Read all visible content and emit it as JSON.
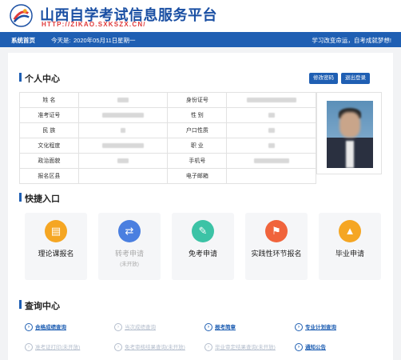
{
  "header": {
    "title": "山西自学考试信息服务平台",
    "url": "HTTP://ZIKAO.SXKSZX.CN/"
  },
  "navbar": {
    "home": "系统首页",
    "date_label": "今天是:",
    "date": "2020年05月11日",
    "weekday": "星期一",
    "slogan": "学习改变命运，自考成就梦想!"
  },
  "profile": {
    "title": "个人中心",
    "buttons": {
      "change_password": "修改密码",
      "logout": "退出登录"
    },
    "rows": [
      {
        "left_label": "姓    名",
        "right_label": "身份证号"
      },
      {
        "left_label": "准考证号",
        "right_label": "性    别"
      },
      {
        "left_label": "民    族",
        "right_label": "户口性质"
      },
      {
        "left_label": "文化程度",
        "right_label": "职    业"
      },
      {
        "left_label": "政治面貌",
        "right_label": "手机号"
      },
      {
        "left_label": "报名区县",
        "right_label": "电子邮箱"
      }
    ]
  },
  "quick": {
    "title": "快捷入口",
    "cards": [
      {
        "label": "理论课报名",
        "sub": "",
        "color": "#f5a623",
        "icon": "document-icon"
      },
      {
        "label": "转考申请",
        "sub": "(未开放)",
        "color": "#4a7fe0",
        "icon": "transfer-icon"
      },
      {
        "label": "免考申请",
        "sub": "",
        "color": "#3cc3a6",
        "icon": "edit-icon"
      },
      {
        "label": "实践性环节报名",
        "sub": "",
        "color": "#f0643c",
        "icon": "flag-icon"
      },
      {
        "label": "毕业申请",
        "sub": "",
        "color": "#f5a623",
        "icon": "graduation-cap-icon"
      }
    ]
  },
  "query": {
    "title": "查询中心",
    "items": [
      {
        "label": "合格成绩查询",
        "enabled": true
      },
      {
        "label": "当次成绩查询",
        "enabled": false
      },
      {
        "label": "报考简章",
        "enabled": true
      },
      {
        "label": "专业计划查询",
        "enabled": true
      },
      {
        "label": "准考证打印(未开放)",
        "enabled": false
      },
      {
        "label": "免考审核结果查询(未开放)",
        "enabled": false
      },
      {
        "label": "毕业审定结果查询(未开放)",
        "enabled": false
      },
      {
        "label": "通知公告",
        "enabled": true
      }
    ]
  },
  "colors": {
    "primary": "#1f5fb3",
    "url_red": "#e03a3a"
  }
}
